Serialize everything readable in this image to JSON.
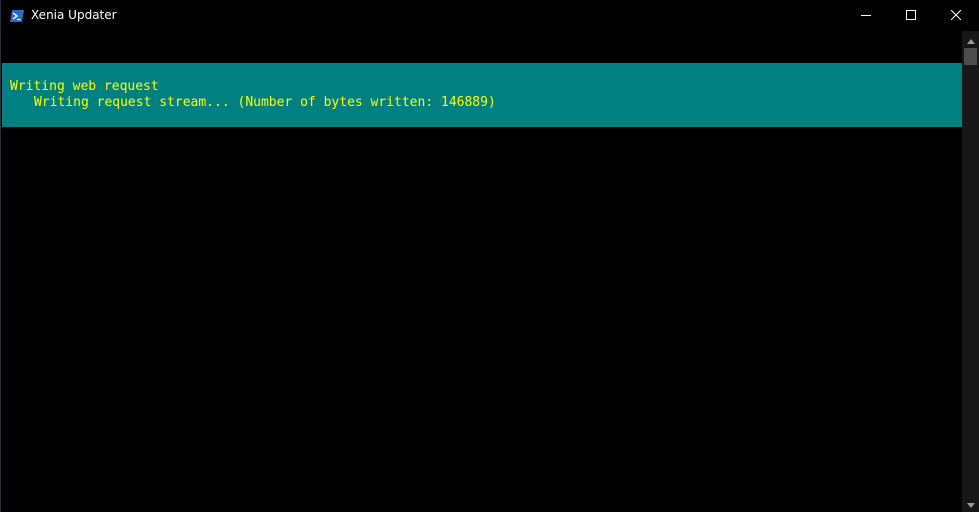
{
  "window": {
    "title": "Xenia Updater",
    "app_icon": "powershell-icon",
    "controls": {
      "minimize_icon": "minimize-icon",
      "maximize_icon": "maximize-icon",
      "close_icon": "close-icon"
    }
  },
  "console": {
    "progress_activity": "Writing web request",
    "progress_status": "Writing request stream... (Number of bytes written: 146889)",
    "colors": {
      "background": "#000000",
      "progress_background": "#008080",
      "progress_text": "#ffff00"
    }
  },
  "scrollbar": {
    "up_icon": "scroll-up-arrow-icon",
    "down_icon": "scroll-down-arrow-icon"
  }
}
